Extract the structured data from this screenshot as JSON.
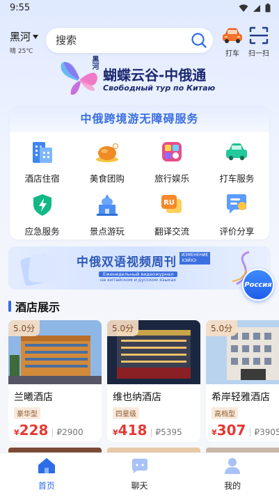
{
  "status": {
    "time": "9:55"
  },
  "location": {
    "city": "黑河",
    "weather": "晴 25℃"
  },
  "search": {
    "placeholder": "搜索"
  },
  "topbar": {
    "taxi_label": "打车",
    "scan_label": "扫一扫"
  },
  "banner": {
    "tag": "黑河",
    "title": "蝴蝶云谷-中俄通",
    "subtitle": "Свободный тур по Китаю"
  },
  "services": {
    "title": "中俄跨境游无障碍服务",
    "items": [
      {
        "label": "酒店住宿",
        "icon": "hotel-building-icon"
      },
      {
        "label": "美食团购",
        "icon": "roast-chicken-icon"
      },
      {
        "label": "旅行娱乐",
        "icon": "travel-app-icon"
      },
      {
        "label": "打车服务",
        "icon": "taxi-car-icon"
      },
      {
        "label": "应急服务",
        "icon": "emergency-shield-icon"
      },
      {
        "label": "景点游玩",
        "icon": "landmark-icon"
      },
      {
        "label": "翻译交流",
        "icon": "translate-ru-icon"
      },
      {
        "label": "评价分享",
        "icon": "review-chat-icon"
      }
    ]
  },
  "video_banner": {
    "title": "中俄双语视频周刊",
    "ru_tag_1": "ИЗМЕНЕНИЕ",
    "ru_tag_2": "ХЭЙХЭ",
    "sub_1": "Еженедельный видеожурнал",
    "sub_2": "на китайском и русском языках",
    "russia_button": "Россия"
  },
  "hotel_section": {
    "title": "酒店展示"
  },
  "hotels": [
    {
      "rating": "5.0分",
      "name": "兰曦酒店",
      "grade": "豪华型",
      "currency": "¥",
      "price": "228",
      "rub": "₽2900"
    },
    {
      "rating": "5.0分",
      "name": "维也纳酒店",
      "grade": "四星级",
      "currency": "¥",
      "price": "418",
      "rub": "₽5395"
    },
    {
      "rating": "5.0分",
      "name": "希岸轻雅酒店",
      "grade": "高档型",
      "currency": "¥",
      "price": "307",
      "rub": "₽3905"
    }
  ],
  "tabs": [
    {
      "label": "首页",
      "icon": "home-icon",
      "active": true
    },
    {
      "label": "聊天",
      "icon": "chat-icon",
      "active": false
    },
    {
      "label": "我的",
      "icon": "profile-icon",
      "active": false
    }
  ],
  "colors": {
    "accent": "#2f6de8",
    "price": "#e53935",
    "services_title": "#3b6fe0"
  }
}
